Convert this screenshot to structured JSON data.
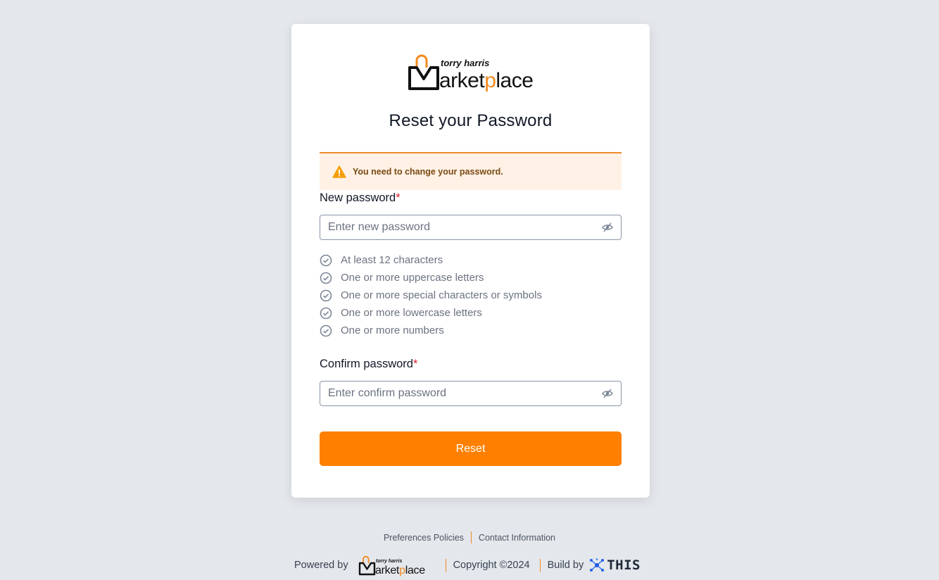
{
  "brand": {
    "name_small": "torry harris",
    "name_main": "Marketplace"
  },
  "page": {
    "title": "Reset your Password"
  },
  "alert": {
    "text": "You need to change your password."
  },
  "new_password": {
    "label": "New password",
    "required_mark": "*",
    "placeholder": "Enter new password"
  },
  "rules": [
    "At least 12 characters",
    "One or more uppercase letters",
    "One or more special characters or symbols",
    "One or more lowercase letters",
    "One or more numbers"
  ],
  "confirm_password": {
    "label": "Confirm password",
    "required_mark": "*",
    "placeholder": "Enter confirm password"
  },
  "reset_button": "Reset",
  "footer": {
    "links": [
      "Preferences Policies",
      "Contact Information"
    ],
    "powered_by": "Powered by",
    "copyright": "Copyright ©2024",
    "build_by": "Build by",
    "build_brand": "THIS"
  },
  "colors": {
    "accent": "#ff8000",
    "alert_bg": "#fff1e5",
    "required": "#e11d2e",
    "page_bg": "#e4e7eb"
  },
  "icons": {
    "alert": "warning-triangle-icon",
    "toggle": "eye-slash-icon",
    "rule": "check-circle-icon"
  }
}
